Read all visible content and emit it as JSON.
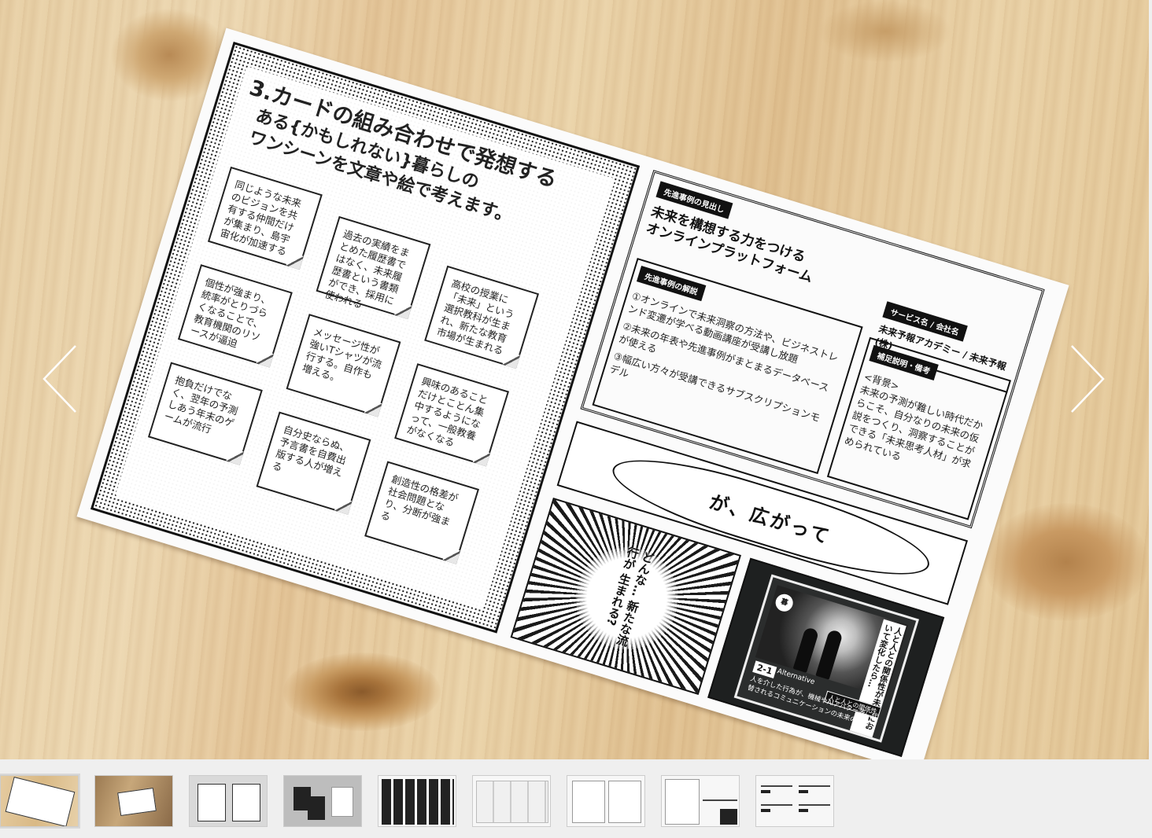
{
  "sheet": {
    "left_page": {
      "title_line1": "3.カードの組み合わせで発想する",
      "title_line2": "ある{かもしれない}暮らしの",
      "title_line3": "ワンシーンを文章や絵で考えます。",
      "notes": [
        "同じような未来のビジョンを共有する仲間だけが集まり、島宇宙化が加速する",
        "過去の実績をまとめた履歴書ではなく、未来履歴書という書類ができ、採用に使われる",
        "高校の授業に「未来」という選択教科が生まれ、新たな教育市場が生まれる",
        "個性が強まり、統率がとりづらくなることで、教育機関のリソースが逼迫",
        "メッセージ性が強いTシャツが流行する。自作も増える。",
        "興味のあることだけとことん集中するようになって、一般教養がなくなる",
        "抱負だけでなく、翌年の予測しあう年末のゲームが流行",
        "自分史ならぬ、予言書を自費出版する人が増える",
        "創造性の格差が社会問題となり、分断が強まる"
      ]
    },
    "right_page": {
      "case_tag": "先進事例の見出し",
      "case_title_line1": "未来を構想する力をつける",
      "case_title_line2": "オンラインプラットフォーム",
      "service_tag": "サービス名 / 会社名",
      "service_name": "未来予報アカデミー / 未来予報(株)",
      "explain_tag": "先進事例の解説",
      "explain_items": [
        "①オンラインで未来洞察の方法や、ビジネストレンド変遷が学べる動画講座が受講し放題",
        "②未来の年表や先進事例がまとまるデータベースが使える",
        "③幅広い方々が受講できるサブスクリプションモデル"
      ],
      "supp_tag": "補足説明・備考",
      "supp_text": "<背景>\n未来の予測が難しい時代だからこそ、自分なりの未来の仮説をつくり、洞察することができる「未来思考人材」が求められている",
      "bubble_text": "が、広がって",
      "burst_text": "どんな… 新たな流行が 生まれる?",
      "card": {
        "icon": "暮",
        "vertical_title": "人と人との関係性が未来において変化したら…",
        "number": "2-1",
        "category": "Alternative",
        "badge": "人と人との関係性",
        "description": "人を介した行為が、機械やAIアバター等に代替されるコミュニケーションの未来の文脈"
      }
    }
  },
  "navigation": {
    "prev_icon": "chevron-left-icon",
    "next_icon": "chevron-right-icon"
  },
  "thumbnails": {
    "count": 9,
    "active_index": 0
  }
}
